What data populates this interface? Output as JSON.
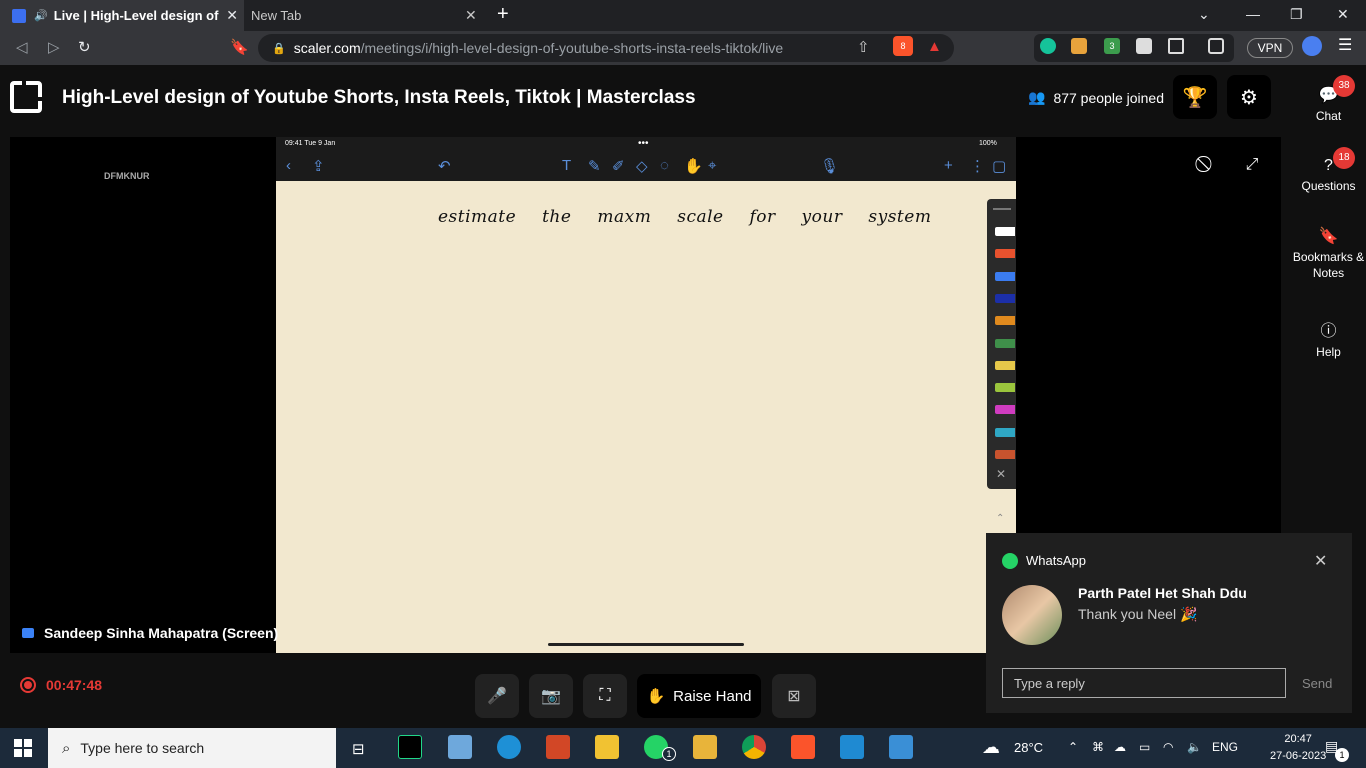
{
  "browser": {
    "active_tab_title": "Live | High-Level design of Youtube Shorts",
    "new_tab_title": "New Tab",
    "url_host": "scaler.com",
    "url_path": "/meetings/i/high-level-design-of-youtube-shorts-insta-reels-tiktok/live",
    "vpn_label": "VPN",
    "brave_badge": "8",
    "ext_badge": "3"
  },
  "header": {
    "title": "High-Level design of Youtube Shorts, Insta Reels, Tiktok | Masterclass",
    "joined": "877 people joined"
  },
  "stage": {
    "watermark": "DFMKNUR",
    "presenter": "Sandeep Sinha Mahapatra (Screen)",
    "ipad_time": "09:41  Tue 9 Jan",
    "ipad_battery": "100%",
    "handwriting": "estimate the maxm scale for your system"
  },
  "controls": {
    "timer": "00:47:48",
    "raise_hand": "Raise Hand"
  },
  "rail": {
    "chat_label": "Chat",
    "chat_count": "38",
    "questions_label": "Questions",
    "questions_count": "18",
    "bookmarks_label": "Bookmarks & Notes",
    "help_label": "Help"
  },
  "notification": {
    "app": "WhatsApp",
    "sender": "Parth Patel Het Shah Ddu",
    "message": "Thank you Neel 🎉",
    "reply_placeholder": "Type a reply",
    "send_label": "Send"
  },
  "taskbar": {
    "search_placeholder": "Type here to search",
    "weather": "28°C",
    "language": "ENG",
    "time": "20:47",
    "date": "27-06-2023",
    "notif_count": "1",
    "whatsapp_badge": "1"
  },
  "colors": {
    "accent_red": "#e53935",
    "canvas": "#f2e8cf",
    "pen_colors": [
      "#ffffff",
      "#e8522e",
      "#3b7cf0",
      "#1c2fa8",
      "#e08a1e",
      "#3f8f4a",
      "#e6c84a",
      "#9bc53d",
      "#d03cc0",
      "#2fa7c4",
      "#c8532e"
    ]
  }
}
